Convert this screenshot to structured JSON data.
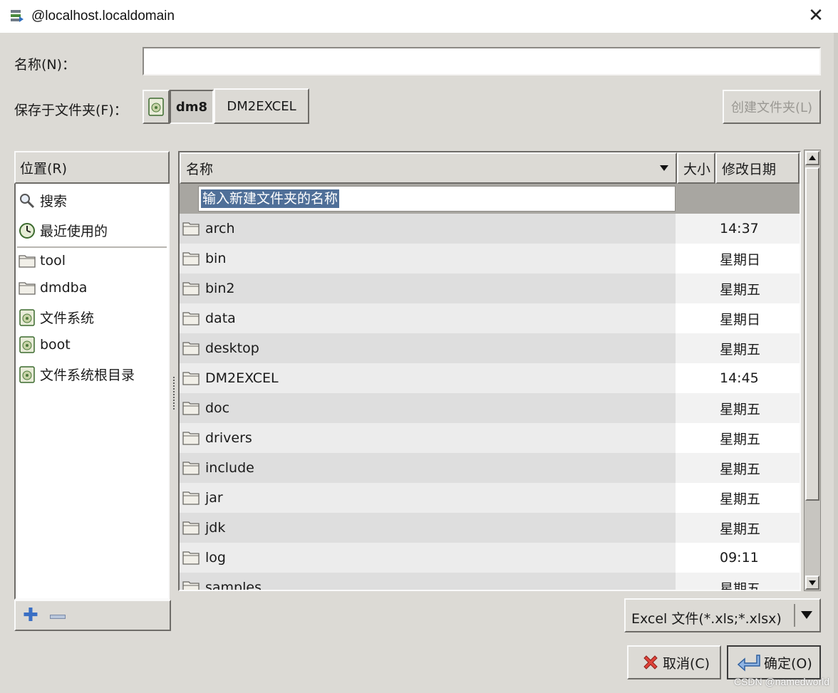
{
  "window": {
    "title": "@localhost.localdomain"
  },
  "name_row": {
    "label": "名称(N)：",
    "value": ""
  },
  "folder_row": {
    "label": "保存于文件夹(F)：",
    "path": [
      "dm8",
      "DM2EXCEL"
    ],
    "create_folder_label": "创建文件夹(L)"
  },
  "places": {
    "header": "位置(R)",
    "items": [
      {
        "label": "搜索",
        "icon": "search-icon"
      },
      {
        "label": "最近使用的",
        "icon": "recent-icon"
      },
      {
        "label": "tool",
        "icon": "folder-icon"
      },
      {
        "label": "dmdba",
        "icon": "folder-icon"
      },
      {
        "label": "文件系统",
        "icon": "drive-icon"
      },
      {
        "label": "boot",
        "icon": "drive-icon"
      },
      {
        "label": "文件系统根目录",
        "icon": "drive-icon"
      }
    ]
  },
  "files": {
    "columns": {
      "name": "名称",
      "size": "大小",
      "modified": "修改日期"
    },
    "new_folder_placeholder": "输入新建文件夹的名称",
    "rows": [
      {
        "name": "arch",
        "modified": "14:37"
      },
      {
        "name": "bin",
        "modified": "星期日"
      },
      {
        "name": "bin2",
        "modified": "星期五"
      },
      {
        "name": "data",
        "modified": "星期日"
      },
      {
        "name": "desktop",
        "modified": "星期五"
      },
      {
        "name": "DM2EXCEL",
        "modified": "14:45"
      },
      {
        "name": "doc",
        "modified": "星期五"
      },
      {
        "name": "drivers",
        "modified": "星期五"
      },
      {
        "name": "include",
        "modified": "星期五"
      },
      {
        "name": "jar",
        "modified": "星期五"
      },
      {
        "name": "jdk",
        "modified": "星期五"
      },
      {
        "name": "log",
        "modified": "09:11"
      },
      {
        "name": "samples",
        "modified": "星期五"
      }
    ]
  },
  "filter": {
    "selected": "Excel 文件(*.xls;*.xlsx)"
  },
  "buttons": {
    "cancel": "取消(C)",
    "ok": "确定(O)"
  },
  "watermark": "CSDN @namedworld"
}
